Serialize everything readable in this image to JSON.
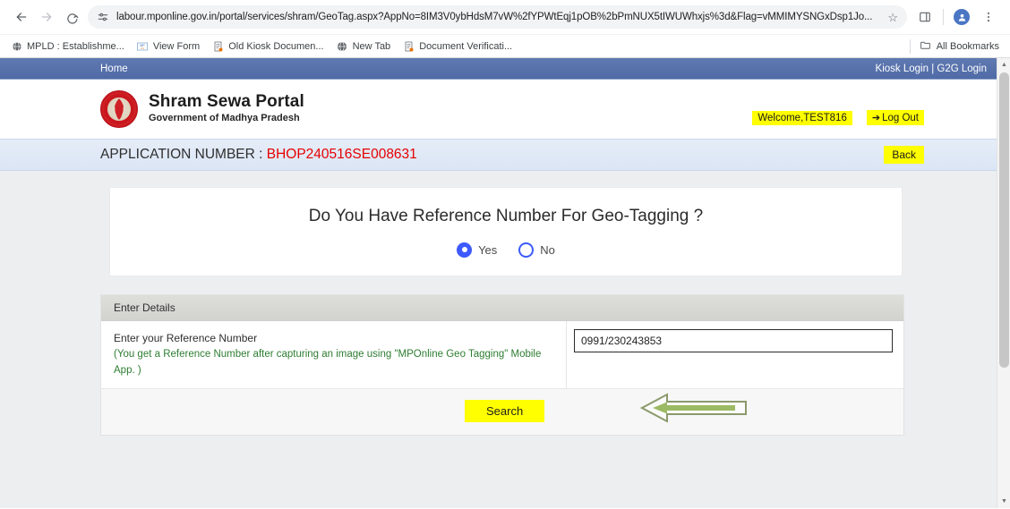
{
  "browser": {
    "url": "labour.mponline.gov.in/portal/services/shram/GeoTag.aspx?AppNo=8IM3V0ybHdsM7vW%2fYPWtEqj1pOB%2bPmNUX5tIWUWhxjs%3d&Flag=vMMIMYSNGxDsp1Jo...",
    "back_icon": "back-arrow-icon",
    "forward_icon": "forward-arrow-icon",
    "reload_icon": "reload-icon",
    "site_info_icon": "site-settings-icon",
    "star_icon": "bookmark-star-icon",
    "sidepanel_icon": "side-panel-icon",
    "profile_icon": "profile-avatar-icon",
    "menu_icon": "three-dot-menu-icon",
    "bookmarks": [
      {
        "label": "MPLD : Establishme...",
        "icon": "globe-icon"
      },
      {
        "label": "View Form",
        "icon": "mponline-icon"
      },
      {
        "label": "Old Kiosk Documen...",
        "icon": "document-icon"
      },
      {
        "label": "New Tab",
        "icon": "globe-icon"
      },
      {
        "label": "Document Verificati...",
        "icon": "document-icon"
      }
    ],
    "all_bookmarks_label": "All Bookmarks",
    "all_bookmarks_icon": "folder-icon"
  },
  "topnav": {
    "home_label": "Home",
    "login_links": "Kiosk Login | G2G Login"
  },
  "header": {
    "emblem_icon": "madhya-pradesh-emblem-icon",
    "title": "Shram Sewa Portal",
    "subtitle": "Government of Madhya Pradesh",
    "welcome_text": "Welcome,TEST816",
    "logout_label": "Log Out",
    "logout_icon": "logout-arrow-icon"
  },
  "appbar": {
    "label": "APPLICATION NUMBER : ",
    "number": "BHOP240516SE008631",
    "back_label": "Back"
  },
  "question_card": {
    "title": "Do You Have Reference Number For Geo-Tagging ?",
    "options": [
      {
        "label": "Yes",
        "checked": true
      },
      {
        "label": "No",
        "checked": false
      }
    ]
  },
  "details_panel": {
    "heading": "Enter Details",
    "field_label": "Enter your Reference Number",
    "field_hint": "(You get a Reference Number after capturing an image using \"MPOnline Geo Tagging\" Mobile App. )",
    "reference_number_value": "0991/230243853",
    "reference_number_placeholder": "",
    "search_label": "Search"
  },
  "annotation": {
    "arrow_icon": "left-pointing-block-arrow-icon"
  },
  "colors": {
    "topnav_blue": "#5a74ad",
    "appbar_blue": "#e0e9f7",
    "highlight_yellow": "#ffff00",
    "app_number_red": "#e60000",
    "hint_green": "#2e7d32",
    "radio_blue": "#3d5afe",
    "arrow_olive": "#8a9a6b"
  }
}
